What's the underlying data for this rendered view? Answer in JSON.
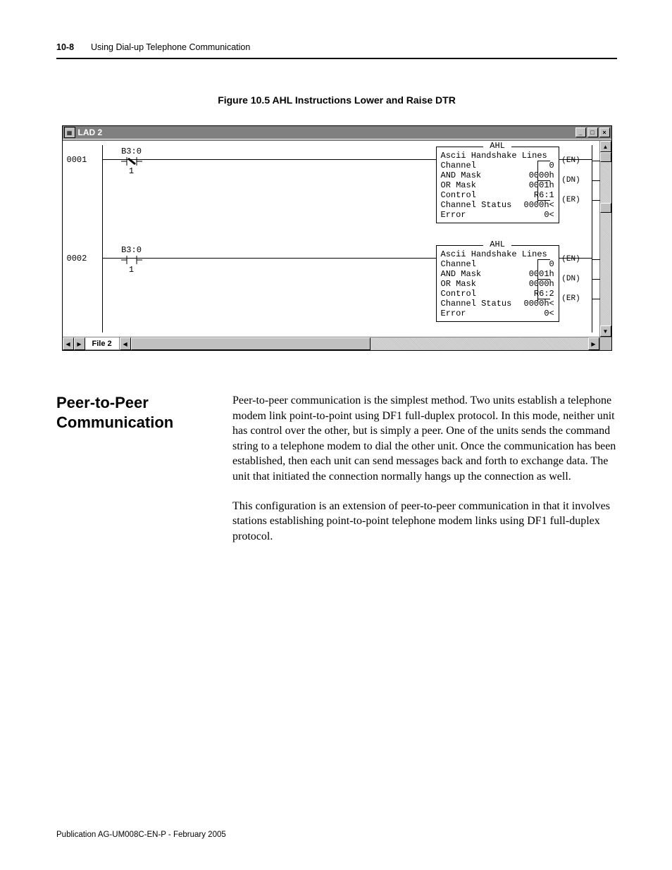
{
  "header": {
    "page_number": "10-8",
    "chapter_title": "Using Dial-up Telephone Communication"
  },
  "figure_caption": "Figure 10.5 AHL Instructions Lower and Raise DTR",
  "lad_window": {
    "title": "LAD 2",
    "tab_label": "File 2",
    "rungs": [
      {
        "number": "0001",
        "contact": {
          "address": "B3:0",
          "bit": "1",
          "type": "XIC"
        },
        "ahl": {
          "title": "AHL",
          "subtitle": "Ascii Handshake Lines",
          "rows": [
            {
              "label": "Channel",
              "value": "0"
            },
            {
              "label": "AND Mask",
              "value": "0000h"
            },
            {
              "label": "OR Mask",
              "value": "0001h"
            },
            {
              "label": "Control",
              "value": "R6:1"
            },
            {
              "label": "Channel Status",
              "value": "0000h<"
            },
            {
              "label": "Error",
              "value": "0<"
            }
          ]
        },
        "coils": [
          "EN",
          "DN",
          "ER"
        ]
      },
      {
        "number": "0002",
        "contact": {
          "address": "B3:0",
          "bit": "1",
          "type": "XIO"
        },
        "ahl": {
          "title": "AHL",
          "subtitle": "Ascii Handshake Lines",
          "rows": [
            {
              "label": "Channel",
              "value": "0"
            },
            {
              "label": "AND Mask",
              "value": "0001h"
            },
            {
              "label": "OR Mask",
              "value": "0000h"
            },
            {
              "label": "Control",
              "value": "R6:2"
            },
            {
              "label": "Channel Status",
              "value": "0000h<"
            },
            {
              "label": "Error",
              "value": "0<"
            }
          ]
        },
        "coils": [
          "EN",
          "DN",
          "ER"
        ]
      }
    ]
  },
  "section": {
    "title": "Peer-to-Peer Communication",
    "paragraphs": [
      "Peer-to-peer communication is the simplest method. Two units establish a telephone modem link point-to-point using DF1 full-duplex protocol. In this mode, neither unit has control over the other, but is simply a peer. One of the units sends the command string to a telephone modem to dial the other unit. Once the communication has been established, then each unit can send messages back and forth to exchange data. The unit that initiated the connection normally hangs up the connection as well.",
      "This configuration is an extension of peer-to-peer communication in that it involves stations establishing point-to-point telephone modem links using DF1 full-duplex protocol."
    ]
  },
  "footer": "Publication AG-UM008C-EN-P - February 2005"
}
